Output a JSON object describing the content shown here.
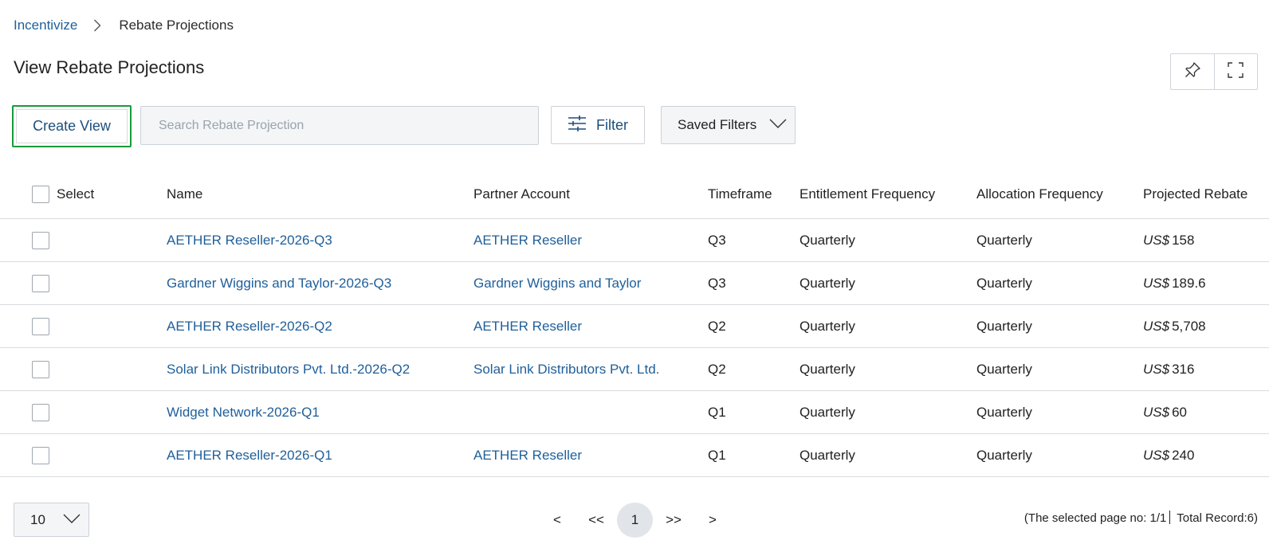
{
  "breadcrumb": {
    "root": "Incentivize",
    "current": "Rebate Projections"
  },
  "page": {
    "title": "View Rebate Projections"
  },
  "icons": {
    "pin": "pin-icon",
    "fullscreen": "fullscreen-icon",
    "filter": "sliders-icon",
    "chevron": "chevron-down-icon",
    "breadcrumb_sep": "chevron-right-icon"
  },
  "toolbar": {
    "create_view": "Create View",
    "search_placeholder": "Search Rebate Projection",
    "filter_label": "Filter",
    "saved_filters": "Saved Filters"
  },
  "table": {
    "headers": {
      "select": "Select",
      "name": "Name",
      "partner": "Partner Account",
      "timeframe": "Timeframe",
      "entitlement": "Entitlement Frequency",
      "allocation": "Allocation Frequency",
      "projected": "Projected Rebate"
    },
    "rows": [
      {
        "name": "AETHER Reseller-2026-Q3",
        "partner": "AETHER Reseller",
        "timeframe": "Q3",
        "entitlement": "Quarterly",
        "allocation": "Quarterly",
        "currency": "US$",
        "amount": "158"
      },
      {
        "name": "Gardner Wiggins and Taylor-2026-Q3",
        "partner": "Gardner Wiggins and Taylor",
        "timeframe": "Q3",
        "entitlement": "Quarterly",
        "allocation": "Quarterly",
        "currency": "US$",
        "amount": "189.6"
      },
      {
        "name": "AETHER Reseller-2026-Q2",
        "partner": "AETHER Reseller",
        "timeframe": "Q2",
        "entitlement": "Quarterly",
        "allocation": "Quarterly",
        "currency": "US$",
        "amount": "5,708"
      },
      {
        "name": "Solar Link Distributors Pvt. Ltd.-2026-Q2",
        "partner": "Solar Link Distributors Pvt. Ltd.",
        "timeframe": "Q2",
        "entitlement": "Quarterly",
        "allocation": "Quarterly",
        "currency": "US$",
        "amount": "316"
      },
      {
        "name": "Widget Network-2026-Q1",
        "partner": "",
        "timeframe": "Q1",
        "entitlement": "Quarterly",
        "allocation": "Quarterly",
        "currency": "US$",
        "amount": "60"
      },
      {
        "name": "AETHER Reseller-2026-Q1",
        "partner": "AETHER Reseller",
        "timeframe": "Q1",
        "entitlement": "Quarterly",
        "allocation": "Quarterly",
        "currency": "US$",
        "amount": "240"
      }
    ]
  },
  "pagination": {
    "page_size": "10",
    "prev": "<",
    "first": "<<",
    "current_page": "1",
    "last": ">>",
    "next": ">",
    "status_prefix": "(The selected page no: 1/1",
    "status_suffix": " Total Record:6)"
  }
}
